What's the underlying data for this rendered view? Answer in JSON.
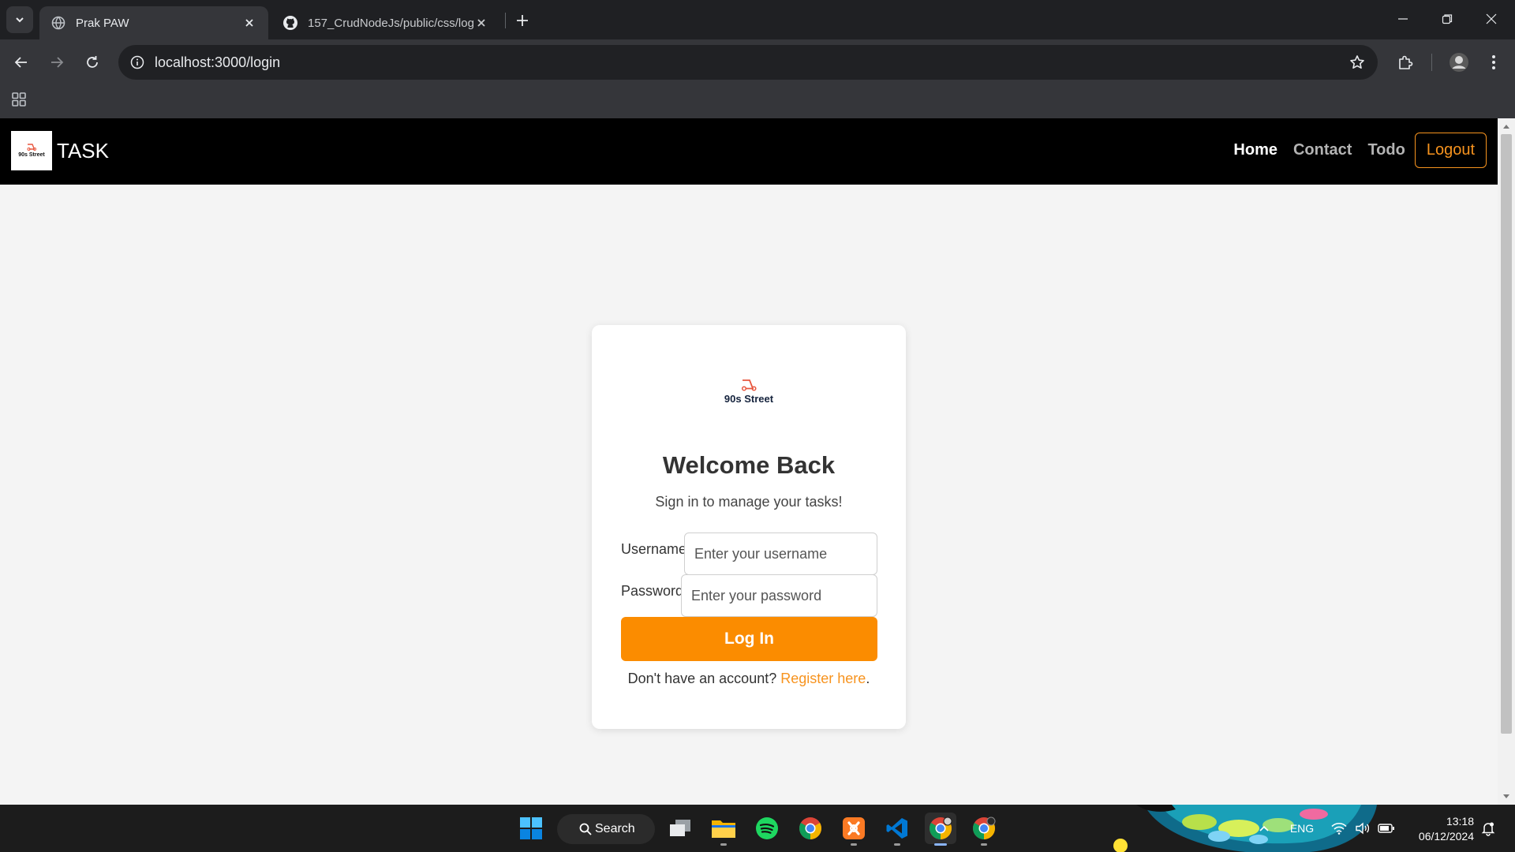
{
  "browser": {
    "tabs": [
      {
        "title": "Prak PAW",
        "active": true,
        "icon": "globe-icon"
      },
      {
        "title": "157_CrudNodeJs/public/css/log",
        "active": false,
        "icon": "github-icon"
      }
    ],
    "address": "localhost:3000/login"
  },
  "navbar": {
    "logo_text": "90s Street",
    "brand": "TASK",
    "links": {
      "home": "Home",
      "contact": "Contact",
      "todo": "Todo",
      "logout": "Logout"
    }
  },
  "login": {
    "logo_text": "90s Street",
    "title": "Welcome Back",
    "subtitle": "Sign in to manage your tasks!",
    "username_label": "Username",
    "username_placeholder": "Enter your username",
    "password_label": "Password",
    "password_placeholder": "Enter your password",
    "button": "Log In",
    "register_prompt": "Don't have an account?",
    "register_link": "Register here",
    "register_suffix": "."
  },
  "taskbar": {
    "search_label": "Search",
    "language": "ENG",
    "time": "13:18",
    "date": "06/12/2024",
    "apps": [
      "windows-start-icon",
      "task-view-icon",
      "file-explorer-icon",
      "spotify-icon",
      "chrome-icon",
      "xampp-icon",
      "vscode-icon",
      "chrome-profile-icon",
      "chrome-profile-icon"
    ]
  },
  "colors": {
    "accent_orange": "#fb8c00",
    "navbar_bg": "#000000",
    "page_bg": "#f4f4f4"
  }
}
